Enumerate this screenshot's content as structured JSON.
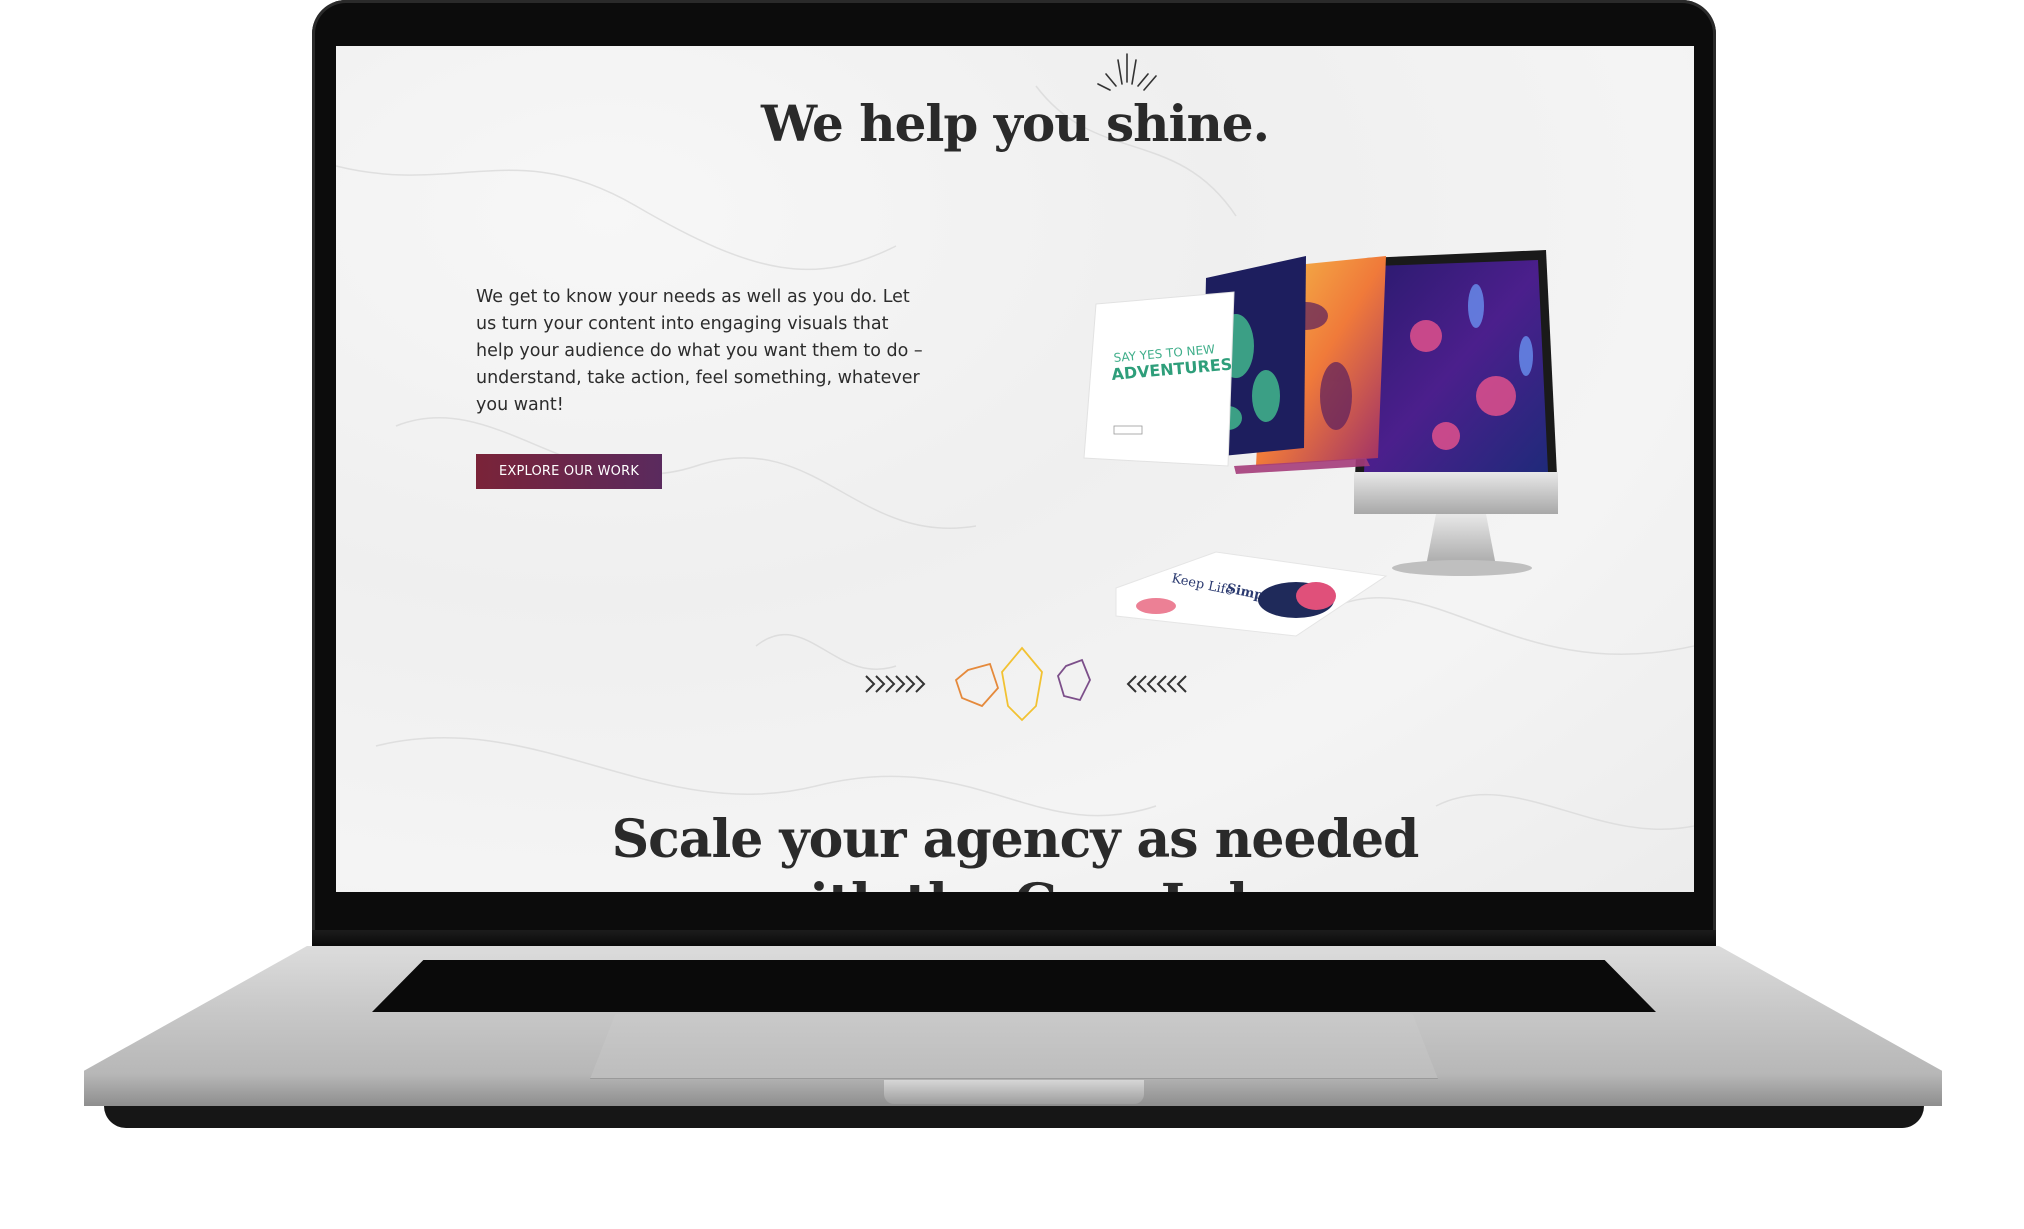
{
  "hero": {
    "headline": "We help you shine.",
    "intro": "We get to know your needs as well as you do. Let us turn your content into engaging visuals that help your audience do what you want them to do – understand, take action, feel something, whatever you want!",
    "cta_label": "EXPLORE OUR WORK"
  },
  "showcase": {
    "card_line1": "SAY YES TO NEW",
    "card_line2": "ADVENTURES",
    "tablet_title_plain": "Keep Life",
    "tablet_title_bold": "Simple"
  },
  "section2": {
    "headline_line1": "Scale your agency as needed",
    "headline_line2": "with the Gem Lab"
  },
  "colors": {
    "cta_start": "#7a2338",
    "cta_end": "#5a2a5e",
    "text_dark": "#2a2a2a",
    "gem_orange": "#e58a3c",
    "gem_yellow": "#f2c232",
    "gem_purple": "#7c4f8a"
  }
}
